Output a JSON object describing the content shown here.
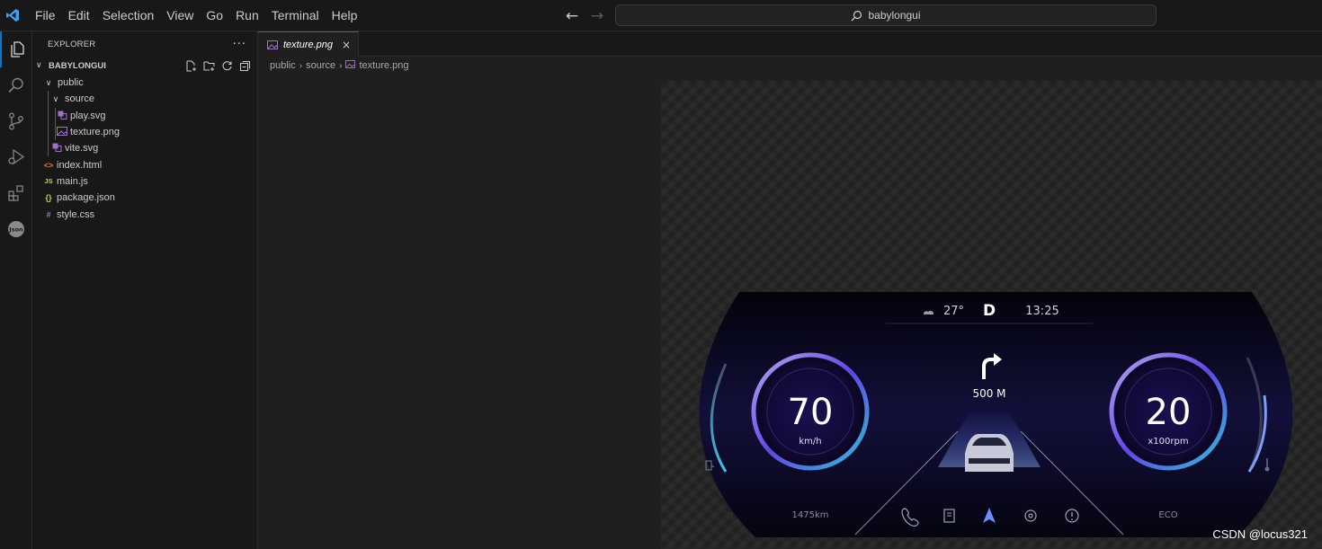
{
  "menubar": [
    "File",
    "Edit",
    "Selection",
    "View",
    "Go",
    "Run",
    "Terminal",
    "Help"
  ],
  "search": {
    "label": "babylongui"
  },
  "explorer": {
    "title": "EXPLORER",
    "more": "···",
    "folder": "BABYLONGUI",
    "tree": [
      {
        "label": "public",
        "icon": ""
      },
      {
        "label": "source",
        "icon": ""
      },
      {
        "label": "play.svg",
        "icon": "svg-file-icon"
      },
      {
        "label": "texture.png",
        "icon": "image-file-icon"
      },
      {
        "label": "vite.svg",
        "icon": "svg-file-icon"
      },
      {
        "label": "index.html",
        "icon": "html-file-icon",
        "glyph": "<>",
        "color": "#e37933"
      },
      {
        "label": "main.js",
        "icon": "js-file-icon",
        "glyph": "JS",
        "color": "#cbcb41"
      },
      {
        "label": "package.json",
        "icon": "json-file-icon",
        "glyph": "{}",
        "color": "#cbcb41"
      },
      {
        "label": "style.css",
        "icon": "css-file-icon",
        "glyph": "#",
        "color": "#519aba"
      }
    ]
  },
  "tab": {
    "label": "texture.png",
    "close": "×"
  },
  "breadcrumb": [
    "public",
    "source",
    "texture.png"
  ],
  "dashboard": {
    "temperature": "27°",
    "gear": "D",
    "time": "13:25",
    "nav_distance": "500 M",
    "speed": "70",
    "speed_unit": "km/h",
    "rpm": "20",
    "rpm_unit": "x100rpm",
    "odometer": "1475km",
    "mode": "ECO"
  },
  "watermark": "CSDN @locus321",
  "colors": {
    "accent": "#0078d4",
    "file_svg": "#a074c4"
  }
}
